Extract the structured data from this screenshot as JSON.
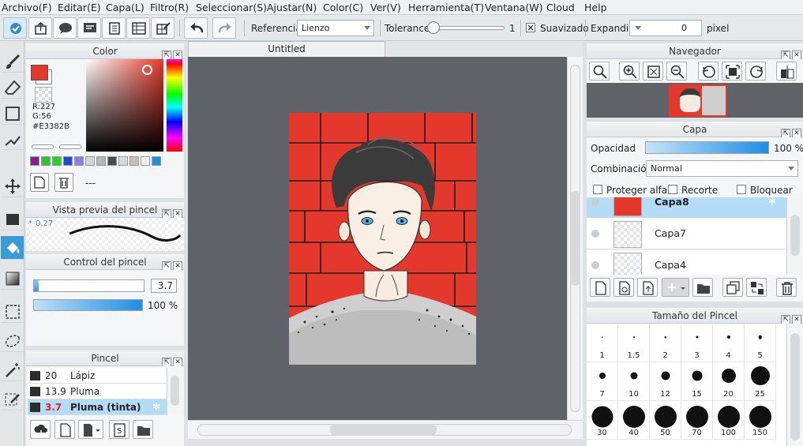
{
  "menu": [
    "Archivo(F)",
    "Editar(E)",
    "Capa(L)",
    "Filtro(R)",
    "Seleccionar(S)",
    "Ajustar(N)",
    "Color(C)",
    "Ver(V)",
    "Herramienta(T)",
    "Ventana(W)",
    "Cloud",
    "Help"
  ],
  "toolbar": {
    "reference_label": "Referencia",
    "reference_value": "Lienzo",
    "tolerance_label": "Tolerance",
    "tolerance_value": "1",
    "smoothing_label": "Suavizado",
    "expand_label": "Expandir",
    "expand_value": "0",
    "unit": "pixel"
  },
  "color_panel": {
    "title": "Color",
    "r": "R:227",
    "g": "G:56",
    "hex": "#E3382B",
    "main_color": "#e3382b",
    "custom_label": "---",
    "palette": [
      "#8a1c8e",
      "#2fc42f",
      "#2bd12b",
      "#1e4ad6",
      "#8b7ee8",
      "#d3d6da",
      "#b2b6ba",
      "#4c4c4c",
      "#d9d9d9",
      "#c8c2aa",
      "#eeeeee",
      "#1f8fe0"
    ]
  },
  "brush_preview": {
    "title": "Vista previa del pincel",
    "size": "0.27"
  },
  "brush_control": {
    "title": "Control del pincel",
    "size": "3.7",
    "opacity": "100 %"
  },
  "brush_panel": {
    "title": "Pincel",
    "items": [
      {
        "size": "20",
        "name": "Lápiz"
      },
      {
        "size": "13.9",
        "name": "Pluma"
      },
      {
        "size": "3.7",
        "name": "Pluma (tinta)"
      }
    ]
  },
  "document": {
    "tab_title": "Untitled"
  },
  "navigator": {
    "title": "Navegador"
  },
  "layer_panel": {
    "title": "Capa",
    "opacity_label": "Opacidad",
    "opacity_value": "100 %",
    "blend_label": "Combinación",
    "blend_value": "Normal",
    "protect_alpha": "Proteger alfa",
    "clip": "Recorte",
    "lock": "Bloquear",
    "layers": [
      "Capa8",
      "Capa7",
      "Capa4"
    ]
  },
  "brush_size_panel": {
    "title": "Tamaño del Pincel",
    "sizes": [
      "1",
      "1.5",
      "2",
      "3",
      "4",
      "5",
      "7",
      "10",
      "12",
      "15",
      "20",
      "25",
      "30",
      "40",
      "50",
      "70",
      "100",
      "150"
    ]
  }
}
